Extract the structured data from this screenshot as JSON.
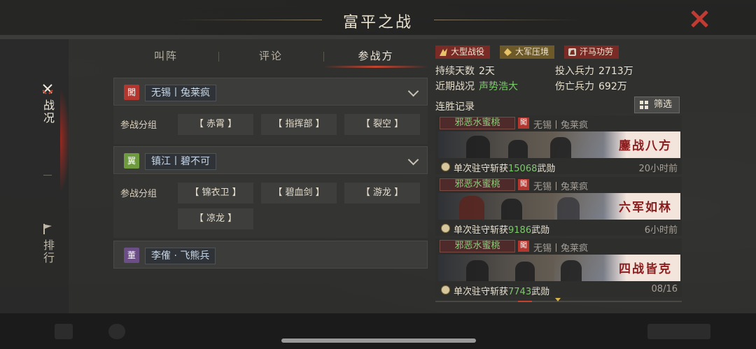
{
  "title": "富平之战",
  "sidenav": {
    "items": [
      {
        "label": "战况",
        "icon": "crossed-swords-icon",
        "active": true
      },
      {
        "label": "排行",
        "icon": "flag-icon",
        "active": false
      }
    ]
  },
  "tabs": [
    {
      "label": "叫阵",
      "active": false
    },
    {
      "label": "评论",
      "active": false
    },
    {
      "label": "参战方",
      "active": true
    }
  ],
  "factions": [
    {
      "badge": "闖",
      "badge_color": "#b3372f",
      "name": "无锡丨兔莱疯",
      "group_label": "参战分组",
      "groups": [
        "【 赤霄 】",
        "【 指挥部 】",
        "【 裂空 】"
      ]
    },
    {
      "badge": "翼",
      "badge_color": "#6e9b3d",
      "name": "镇江丨碧不可",
      "group_label": "参战分组",
      "groups": [
        "【 锦衣卫 】",
        "【 碧血剑 】",
        "【 游龙 】",
        "【 凉龙 】"
      ]
    },
    {
      "badge": "董",
      "badge_color": "#6c4e86",
      "name": "李傕 · 飞熊兵"
    }
  ],
  "battle_tags": [
    {
      "label": "大型战役",
      "icon": "battle-icon"
    },
    {
      "label": "大军压境",
      "icon": "army-icon"
    },
    {
      "label": "汗马功劳",
      "icon": "horse-icon"
    }
  ],
  "stats": {
    "duration_label": "持续天数",
    "duration_value": "2天",
    "troops_label": "投入兵力",
    "troops_value": "2713万",
    "recent_label": "近期战况",
    "recent_value": "声势浩大",
    "casualty_label": "伤亡兵力",
    "casualty_value": "692万"
  },
  "records_title": "连胜记录",
  "filter_label": "筛选",
  "records": [
    {
      "player": "邪恶水蜜桃",
      "opponent_badge": "闖",
      "opponent": "无锡丨兔莱疯",
      "banner_text": "鏖战八方",
      "desc_prefix": "单次驻守斩获",
      "desc_number": "15068",
      "desc_suffix": "武勋",
      "time": "20小时前"
    },
    {
      "player": "邪恶水蜜桃",
      "opponent_badge": "闖",
      "opponent": "无锡丨兔莱疯",
      "banner_text": "六军如林",
      "desc_prefix": "单次驻守斩获",
      "desc_number": "9186",
      "desc_suffix": "武勋",
      "time": "6小时前"
    },
    {
      "player": "邪恶水蜜桃",
      "opponent_badge": "闖",
      "opponent": "无锡丨兔莱疯",
      "banner_text": "四战皆克",
      "desc_prefix": "单次驻守斩获",
      "desc_number": "7743",
      "desc_suffix": "武勋",
      "time": "08/16"
    }
  ],
  "colors": {
    "accent": "#c4432f",
    "highlight_green": "#7ec86e"
  }
}
